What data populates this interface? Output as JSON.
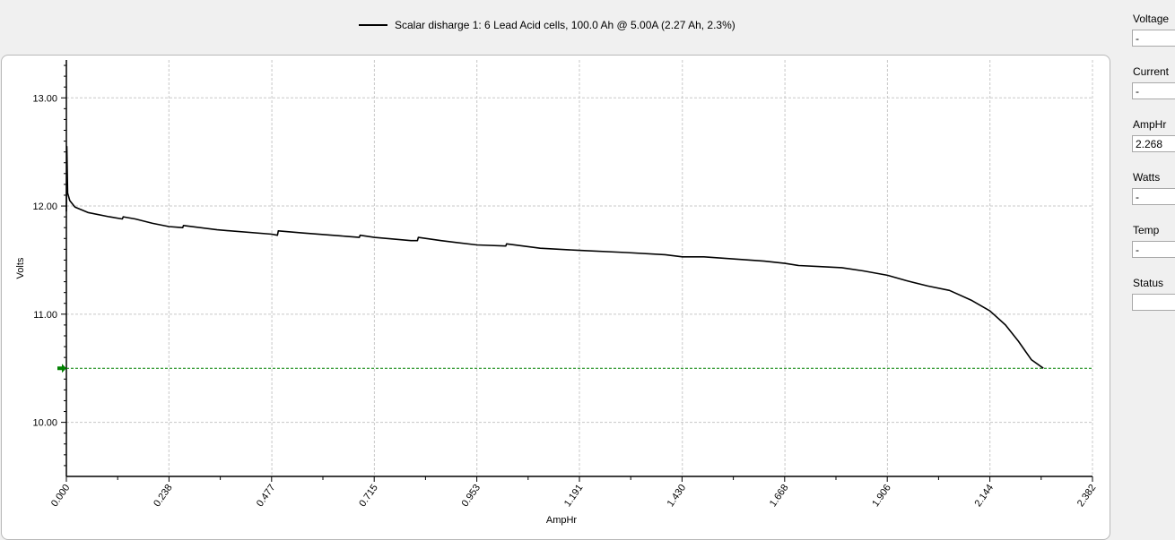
{
  "legend": {
    "label": "Scalar disharge 1: 6 Lead Acid cells, 100.0 Ah @ 5.00A (2.27 Ah, 2.3%)"
  },
  "side_panel": {
    "fields": [
      {
        "label": "Voltage",
        "value": "-"
      },
      {
        "label": "Current",
        "value": "-"
      },
      {
        "label": "AmpHr",
        "value": "2.268"
      },
      {
        "label": "Watts",
        "value": "-"
      },
      {
        "label": "Temp",
        "value": "-"
      },
      {
        "label": "Status",
        "value": ""
      }
    ]
  },
  "chart_data": {
    "type": "line",
    "xlabel": "AmpHr",
    "ylabel": "Volts",
    "xlim": [
      0,
      2.382
    ],
    "ylim": [
      9.5,
      13.35
    ],
    "xticks": [
      "0.000",
      "0.238",
      "0.477",
      "0.715",
      "0.953",
      "1.191",
      "1.430",
      "1.668",
      "1.906",
      "2.144",
      "2.382"
    ],
    "yticks": [
      "10.00",
      "11.00",
      "12.00",
      "13.00"
    ],
    "grid": true,
    "cutoff_voltage": 10.5,
    "cutoff_color": "#008000",
    "series_color": "#000000",
    "series": [
      {
        "name": "Scalar disharge 1: 6 Lead Acid cells, 100.0 Ah @ 5.00A (2.27 Ah, 2.3%)",
        "points": [
          [
            0.0,
            11.95
          ],
          [
            0.001,
            12.55
          ],
          [
            0.003,
            12.12
          ],
          [
            0.008,
            12.05
          ],
          [
            0.02,
            11.99
          ],
          [
            0.05,
            11.94
          ],
          [
            0.1,
            11.9
          ],
          [
            0.13,
            11.88
          ],
          [
            0.132,
            11.9
          ],
          [
            0.16,
            11.88
          ],
          [
            0.2,
            11.84
          ],
          [
            0.238,
            11.81
          ],
          [
            0.27,
            11.8
          ],
          [
            0.272,
            11.82
          ],
          [
            0.35,
            11.78
          ],
          [
            0.477,
            11.74
          ],
          [
            0.49,
            11.73
          ],
          [
            0.492,
            11.77
          ],
          [
            0.55,
            11.75
          ],
          [
            0.65,
            11.72
          ],
          [
            0.68,
            11.71
          ],
          [
            0.682,
            11.73
          ],
          [
            0.715,
            11.71
          ],
          [
            0.8,
            11.68
          ],
          [
            0.815,
            11.68
          ],
          [
            0.817,
            11.71
          ],
          [
            0.87,
            11.68
          ],
          [
            0.953,
            11.64
          ],
          [
            1.02,
            11.63
          ],
          [
            1.022,
            11.65
          ],
          [
            1.1,
            11.61
          ],
          [
            1.191,
            11.59
          ],
          [
            1.3,
            11.57
          ],
          [
            1.39,
            11.55
          ],
          [
            1.43,
            11.53
          ],
          [
            1.48,
            11.53
          ],
          [
            1.55,
            11.51
          ],
          [
            1.62,
            11.49
          ],
          [
            1.668,
            11.47
          ],
          [
            1.7,
            11.45
          ],
          [
            1.75,
            11.44
          ],
          [
            1.8,
            11.43
          ],
          [
            1.85,
            11.4
          ],
          [
            1.906,
            11.36
          ],
          [
            1.95,
            11.31
          ],
          [
            2.0,
            11.26
          ],
          [
            2.05,
            11.22
          ],
          [
            2.1,
            11.13
          ],
          [
            2.144,
            11.03
          ],
          [
            2.18,
            10.9
          ],
          [
            2.21,
            10.75
          ],
          [
            2.24,
            10.58
          ],
          [
            2.268,
            10.5
          ]
        ]
      }
    ]
  }
}
